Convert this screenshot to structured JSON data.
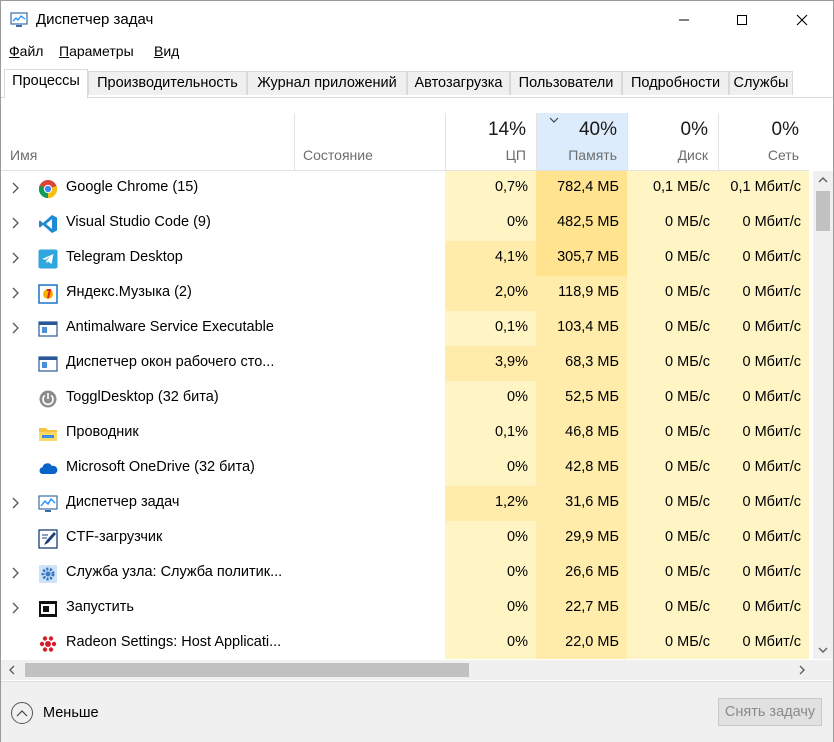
{
  "window": {
    "title": "Диспетчер задач"
  },
  "menu": [
    {
      "label_u": "Ф",
      "label_rest": "айл"
    },
    {
      "label_u": "П",
      "label_rest": "араметры"
    },
    {
      "label_u": "В",
      "label_rest": "ид"
    }
  ],
  "tabs": [
    {
      "label": "Процессы",
      "active": true
    },
    {
      "label": "Производительность"
    },
    {
      "label": "Журнал приложений"
    },
    {
      "label": "Автозагрузка"
    },
    {
      "label": "Пользователи"
    },
    {
      "label": "Подробности"
    },
    {
      "label": "Службы"
    }
  ],
  "columns": {
    "name": "Имя",
    "status": "Состояние",
    "cpu": {
      "percent": "14%",
      "label": "ЦП"
    },
    "memory": {
      "percent": "40%",
      "label": "Память"
    },
    "disk": {
      "percent": "0%",
      "label": "Диск"
    },
    "network": {
      "percent": "0%",
      "label": "Сеть"
    }
  },
  "colors": {
    "heat_light": "#fff4c4",
    "heat_mid": "#ffecaa",
    "heat_strong": "#ffe38e",
    "mem_header": "#dcecfc",
    "accent": "#0078d7"
  },
  "processes": [
    {
      "name": "Google Chrome (15)",
      "icon": "chrome-icon",
      "expandable": true,
      "cpu": "0,7%",
      "memory": "782,4 МБ",
      "disk": "0,1 МБ/с",
      "network": "0,1 Мбит/с"
    },
    {
      "name": "Visual Studio Code (9)",
      "icon": "vscode-icon",
      "expandable": true,
      "cpu": "0%",
      "memory": "482,5 МБ",
      "disk": "0 МБ/с",
      "network": "0 Мбит/с"
    },
    {
      "name": "Telegram Desktop",
      "icon": "telegram-icon",
      "expandable": true,
      "cpu": "4,1%",
      "memory": "305,7 МБ",
      "disk": "0 МБ/с",
      "network": "0 Мбит/с"
    },
    {
      "name": "Яндекс.Музыка (2)",
      "icon": "yandex-music-icon",
      "expandable": true,
      "cpu": "2,0%",
      "memory": "118,9 МБ",
      "disk": "0 МБ/с",
      "network": "0 Мбит/с"
    },
    {
      "name": "Antimalware Service Executable",
      "icon": "service-window-icon",
      "expandable": true,
      "cpu": "0,1%",
      "memory": "103,4 МБ",
      "disk": "0 МБ/с",
      "network": "0 Мбит/с"
    },
    {
      "name": "Диспетчер окон рабочего сто...",
      "icon": "service-window-icon",
      "expandable": false,
      "cpu": "3,9%",
      "memory": "68,3 МБ",
      "disk": "0 МБ/с",
      "network": "0 Мбит/с"
    },
    {
      "name": "TogglDesktop (32 бита)",
      "icon": "toggl-icon",
      "expandable": false,
      "cpu": "0%",
      "memory": "52,5 МБ",
      "disk": "0 МБ/с",
      "network": "0 Мбит/с"
    },
    {
      "name": "Проводник",
      "icon": "explorer-folder-icon",
      "expandable": false,
      "cpu": "0,1%",
      "memory": "46,8 МБ",
      "disk": "0 МБ/с",
      "network": "0 Мбит/с"
    },
    {
      "name": "Microsoft OneDrive (32 бита)",
      "icon": "onedrive-cloud-icon",
      "expandable": false,
      "cpu": "0%",
      "memory": "42,8 МБ",
      "disk": "0 МБ/с",
      "network": "0 Мбит/с"
    },
    {
      "name": "Диспетчер задач",
      "icon": "task-manager-icon",
      "expandable": true,
      "cpu": "1,2%",
      "memory": "31,6 МБ",
      "disk": "0 МБ/с",
      "network": "0 Мбит/с"
    },
    {
      "name": "CTF-загрузчик",
      "icon": "ctf-pen-icon",
      "expandable": false,
      "cpu": "0%",
      "memory": "29,9 МБ",
      "disk": "0 МБ/с",
      "network": "0 Мбит/с"
    },
    {
      "name": "Служба узла: Служба политик...",
      "icon": "gear-service-icon",
      "expandable": true,
      "cpu": "0%",
      "memory": "26,6 МБ",
      "disk": "0 МБ/с",
      "network": "0 Мбит/с"
    },
    {
      "name": "Запустить",
      "icon": "run-dialog-icon",
      "expandable": true,
      "cpu": "0%",
      "memory": "22,7 МБ",
      "disk": "0 МБ/с",
      "network": "0 Мбит/с"
    },
    {
      "name": "Radeon Settings: Host Applicati...",
      "icon": "radeon-icon",
      "expandable": false,
      "cpu": "0%",
      "memory": "22,0 МБ",
      "disk": "0 МБ/с",
      "network": "0 Мбит/с"
    }
  ],
  "footer": {
    "less_label": "Меньше",
    "end_task_label": "Снять задачу"
  }
}
